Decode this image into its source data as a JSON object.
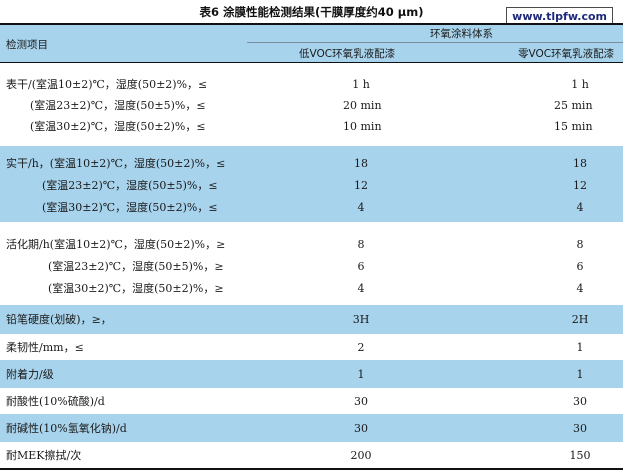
{
  "title": "表6 涂膜性能检测结果(干膜厚度约40 μm)",
  "watermark": "www.tlpfw.com",
  "header": {
    "item_label": "检测项目",
    "group_label": "环氧涂料体系",
    "col1": "低VOC环氧乳液配漆",
    "col2": "零VOC环氧乳液配漆"
  },
  "rows": [
    {
      "label": "表干/(室温10±2)℃，湿度(50±2)%，≤",
      "v1": "1 h",
      "v2": "1 h"
    },
    {
      "label": "(室温23±2)℃，湿度(50±5)%，≤",
      "v1": "20 min",
      "v2": "25 min"
    },
    {
      "label": "(室温30±2)℃，湿度(50±2)%，≤",
      "v1": "10 min",
      "v2": "15 min"
    },
    {
      "label": "实干/h，(室温10±2)℃，湿度(50±2)%，≤",
      "v1": "18",
      "v2": "18"
    },
    {
      "label": "(室温23±2)℃，湿度(50±5)%，≤",
      "v1": "12",
      "v2": "12"
    },
    {
      "label": "(室温30±2)℃，湿度(50±2)%，≤",
      "v1": "4",
      "v2": "4"
    },
    {
      "label": "活化期/h(室温10±2)℃，湿度(50±2)%，≥",
      "v1": "8",
      "v2": "8"
    },
    {
      "label": "(室温23±2)℃，湿度(50±5)%，≥",
      "v1": "6",
      "v2": "6"
    },
    {
      "label": "(室温30±2)℃，湿度(50±2)%，≥",
      "v1": "4",
      "v2": "4"
    },
    {
      "label": "铅笔硬度(划破)，≥，",
      "v1": "3H",
      "v2": "2H"
    },
    {
      "label": "柔韧性/mm，≤",
      "v1": "2",
      "v2": "1"
    },
    {
      "label": "附着力/级",
      "v1": "1",
      "v2": "1"
    },
    {
      "label": "耐酸性(10%硫酸)/d",
      "v1": "30",
      "v2": "30"
    },
    {
      "label": "耐碱性(10%氢氧化钠)/d",
      "v1": "30",
      "v2": "30"
    },
    {
      "label": "耐MEK擦拭/次",
      "v1": "200",
      "v2": "150"
    }
  ]
}
